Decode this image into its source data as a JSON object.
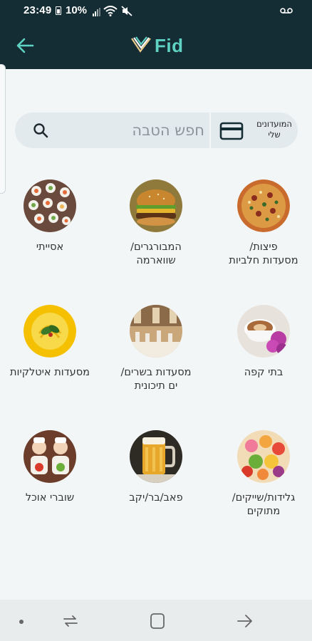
{
  "status": {
    "time": "23:49",
    "battery": "10%"
  },
  "header": {
    "logo_text": "Fid"
  },
  "search": {
    "placeholder": "חפש הטבה",
    "vouchers_line1": "המועדונים",
    "vouchers_line2": "שלי"
  },
  "categories": [
    {
      "label1": "פיצות/",
      "label2": "מסעדות חלביות",
      "image": "pizza"
    },
    {
      "label1": "המבורגרים/",
      "label2": "שווארמה",
      "image": "burger"
    },
    {
      "label1": "אסייתי",
      "label2": "",
      "image": "sushi"
    },
    {
      "label1": "בתי קפה",
      "label2": "",
      "image": "coffee"
    },
    {
      "label1": "מסעדות בשרים/",
      "label2": "ים תיכונית",
      "image": "restaurant"
    },
    {
      "label1": "מסעדות איטלקיות",
      "label2": "",
      "image": "pasta"
    },
    {
      "label1": "גלידות/שייקים/",
      "label2": "מתוקים",
      "image": "ice-cream"
    },
    {
      "label1": "פאב/בר/יקב",
      "label2": "",
      "image": "beer"
    },
    {
      "label1": "שוברי אוכל",
      "label2": "",
      "image": "food-vouchers"
    }
  ],
  "colors": {
    "header_bg": "#142c33",
    "accent": "#5ed3c4",
    "background": "#f3f6f7",
    "search_bg": "#e3eaed"
  }
}
